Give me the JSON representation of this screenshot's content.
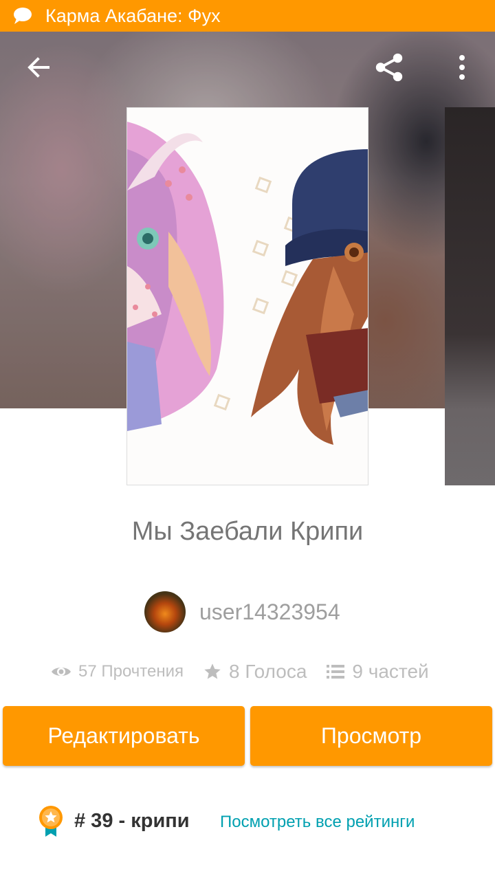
{
  "notification": {
    "text": "Карма Акабане: Фух"
  },
  "header": {
    "back_icon": "arrow-left-icon",
    "share_icon": "share-icon",
    "more_icon": "more-vert-icon"
  },
  "story": {
    "title": "Мы Заебали Крипи",
    "author": "user14323954"
  },
  "stats": {
    "reads": "57 Прочтения",
    "votes": "8 Голоса",
    "parts": "9 частей"
  },
  "actions": {
    "edit_label": "Редактировать",
    "view_label": "Просмотр"
  },
  "ranking": {
    "rank_text": "# 39 - крипи",
    "link_text": "Посмотреть все рейтинги"
  },
  "colors": {
    "accent": "#ff9800",
    "link": "#00a0b0"
  }
}
